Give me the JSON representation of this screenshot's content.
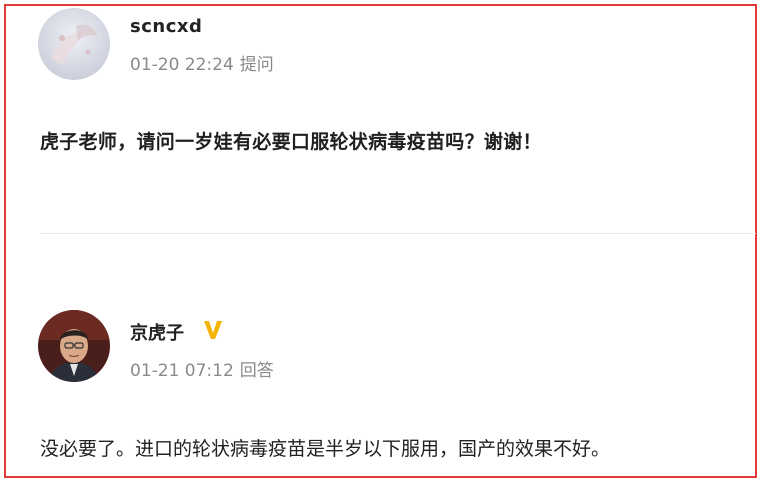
{
  "question": {
    "username": "scncxd",
    "time": "01-20 22:24",
    "action": "提问",
    "text": "虎子老师，请问一岁娃有必要口服轮状病毒疫苗吗？谢谢！"
  },
  "answer": {
    "username": "京虎子",
    "verified_badge": "V",
    "time": "01-21 07:12",
    "action": "回答",
    "text": "没必要了。进口的轮状病毒疫苗是半岁以下服用，国产的效果不好。"
  },
  "colors": {
    "highlight_border": "#e23b35",
    "meta_gray": "#8a8a8a",
    "verified_gold": "#f4b400"
  }
}
